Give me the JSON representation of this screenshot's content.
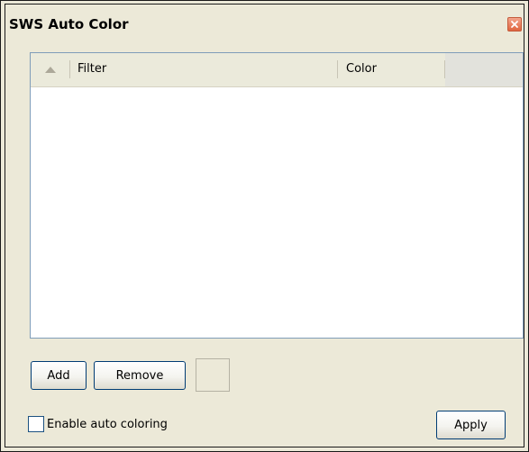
{
  "window": {
    "title": "SWS Auto Color",
    "close_icon": "close-icon"
  },
  "list": {
    "sort_icon": "sort-ascending-icon",
    "columns": [
      "Filter",
      "Color"
    ],
    "rows": []
  },
  "buttons": {
    "add": "Add",
    "remove": "Remove",
    "apply": "Apply"
  },
  "color_swatch": {
    "color": "#ece9d8"
  },
  "options": {
    "enable_auto_coloring": {
      "label": "Enable auto coloring",
      "checked": false
    }
  },
  "colors": {
    "dialog_background": "#ece9d8",
    "list_background": "#ffffff",
    "header_background": "#ebeadb",
    "close_button": "#e0653e"
  }
}
